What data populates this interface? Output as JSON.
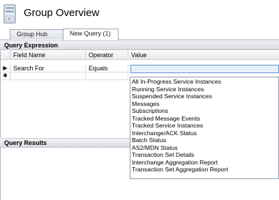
{
  "window": {
    "title": "Group Overview",
    "icon": "biztalk-group-icon"
  },
  "tabs": [
    {
      "label": "Group Hub",
      "active": false
    },
    {
      "label": "New Query (1)",
      "active": true
    }
  ],
  "query_expression": {
    "header": "Query Expression",
    "columns": {
      "field_name": "Field Name",
      "operator": "Operator",
      "value": "Value"
    },
    "rows": [
      {
        "marker": "▶",
        "field": "Search For",
        "operator": "Equals",
        "value": ""
      },
      {
        "marker": "✱",
        "field": "",
        "operator": "",
        "value": ""
      }
    ],
    "value_options": [
      "All In-Progress Service Instances",
      "Running Service Instances",
      "Suspended Service Instances",
      "Messages",
      "Subscriptions",
      "Tracked Message Events",
      "Tracked Service Instances",
      "Interchange/ACK Status",
      "Batch Status",
      "AS2/MDN Status",
      "Transaction Set Details",
      "Interchange Aggregation Report",
      "Transaction Set Aggregation Report"
    ]
  },
  "query_results": {
    "header": "Query Results"
  }
}
